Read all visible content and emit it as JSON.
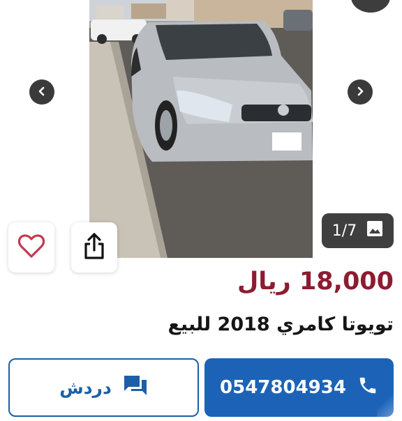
{
  "gallery": {
    "counter_text": "1/7",
    "icons": {
      "prev": "chevron-left-icon",
      "next": "chevron-right-icon",
      "image": "image-icon"
    }
  },
  "actions": {
    "favorite_icon": "heart-outline-icon",
    "share_icon": "share-icon"
  },
  "listing": {
    "price": "18,000 ريال",
    "title": "تويوتا كامري 2018 للبيع"
  },
  "contact": {
    "chat_label": "دردش",
    "phone_number": "0547804934",
    "chat_icon": "chat-bubble-icon",
    "call_icon": "phone-icon"
  },
  "colors": {
    "price": "#8d1b31",
    "primary": "#1c63b8",
    "overlay": "#3f3f3f"
  }
}
